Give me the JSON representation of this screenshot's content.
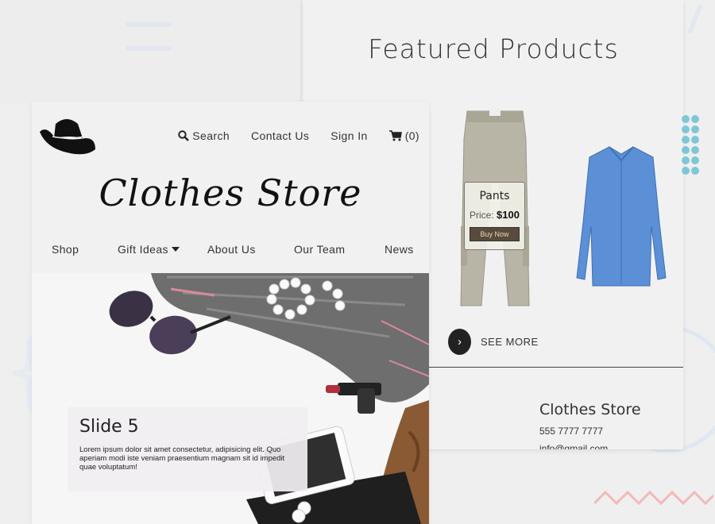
{
  "featured": {
    "title": "Featured Products",
    "product": {
      "name": "Pants",
      "price_label": "Price:",
      "price": "$100",
      "buy_label": "Buy Now"
    },
    "see_more": "SEE MORE"
  },
  "footer": {
    "store_name": "Clothes Store",
    "phone": "555 7777 7777",
    "email": "info@gmail.com"
  },
  "header": {
    "logo": "hat-logo-icon",
    "nav": {
      "search": "Search",
      "contact": "Contact Us",
      "sign_in": "Sign In",
      "cart": "(0)"
    },
    "store_title": "Clothes Store"
  },
  "main_nav": {
    "items": [
      "Shop",
      "Gift Ideas",
      "About Us",
      "Our Team",
      "News"
    ]
  },
  "hero": {
    "slide_title": "Slide 5",
    "slide_text": "Lorem ipsum dolor sit amet consectetur, adipisicing elit. Quo aperiam modi iste veniam praesentium magnam sit id impedit quae voluptatum!"
  },
  "colors": {
    "accent_dots": "#7fc7d6",
    "buy_button": "#5a4a3e",
    "zigzag": "#f4b8b8"
  }
}
